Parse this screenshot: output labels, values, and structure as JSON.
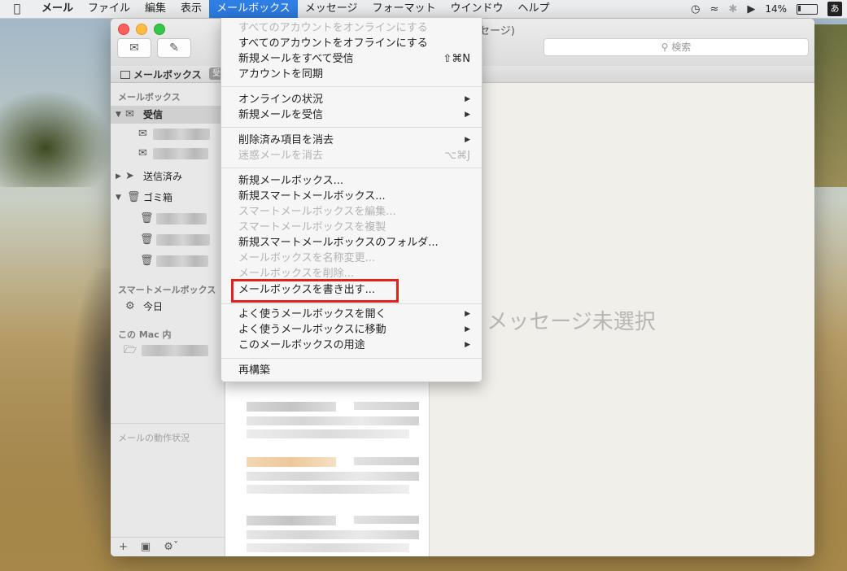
{
  "menubar": {
    "apple": "",
    "items": [
      "メール",
      "ファイル",
      "編集",
      "表示",
      "メールボックス",
      "メッセージ",
      "フォーマット",
      "ウインドウ",
      "ヘルプ"
    ],
    "battery": "14%",
    "user": "あ"
  },
  "window": {
    "title_fragment": "ッセージ)",
    "search_placeholder": "検索",
    "favbar_label": "メールボックス",
    "favbar_tag": "受"
  },
  "sidebar": {
    "section_mailboxes": "メールボックス",
    "inbox": "受信",
    "sent": "送信済み",
    "trash": "ゴミ箱",
    "section_smart": "スマートメールボックス",
    "today": "今日",
    "section_onmac": "この Mac 内",
    "activity": "メールの動作状況"
  },
  "viewer": {
    "empty_message": "メッセージ未選択"
  },
  "menu": {
    "items": [
      {
        "label": "すべてのアカウントをオンラインにする",
        "disabled": true
      },
      {
        "label": "すべてのアカウントをオフラインにする",
        "disabled": false
      },
      {
        "label": "新規メールをすべて受信",
        "disabled": false,
        "shortcut": "⇧⌘N"
      },
      {
        "label": "アカウントを同期",
        "disabled": false
      },
      {
        "label": "オンラインの状況",
        "disabled": false,
        "submenu": true
      },
      {
        "label": "新規メールを受信",
        "disabled": false,
        "submenu": true
      },
      {
        "label": "削除済み項目を消去",
        "disabled": false,
        "submenu": true
      },
      {
        "label": "迷惑メールを消去",
        "disabled": true,
        "shortcut": "⌥⌘J"
      },
      {
        "label": "新規メールボックス...",
        "disabled": false
      },
      {
        "label": "新規スマートメールボックス...",
        "disabled": false
      },
      {
        "label": "スマートメールボックスを編集...",
        "disabled": true
      },
      {
        "label": "スマートメールボックスを複製",
        "disabled": true
      },
      {
        "label": "新規スマートメールボックスのフォルダ...",
        "disabled": false
      },
      {
        "label": "メールボックスを名称変更...",
        "disabled": true
      },
      {
        "label": "メールボックスを削除...",
        "disabled": true
      },
      {
        "label": "メールボックスを書き出す...",
        "disabled": false,
        "highlighted": true
      },
      {
        "label": "よく使うメールボックスを開く",
        "disabled": false,
        "submenu": true
      },
      {
        "label": "よく使うメールボックスに移動",
        "disabled": false,
        "submenu": true
      },
      {
        "label": "このメールボックスの用途",
        "disabled": false,
        "submenu": true
      },
      {
        "label": "再構築",
        "disabled": false
      }
    ]
  },
  "colors": {
    "menu_active": "#2f7fe6",
    "highlight_border": "#e3201b"
  }
}
